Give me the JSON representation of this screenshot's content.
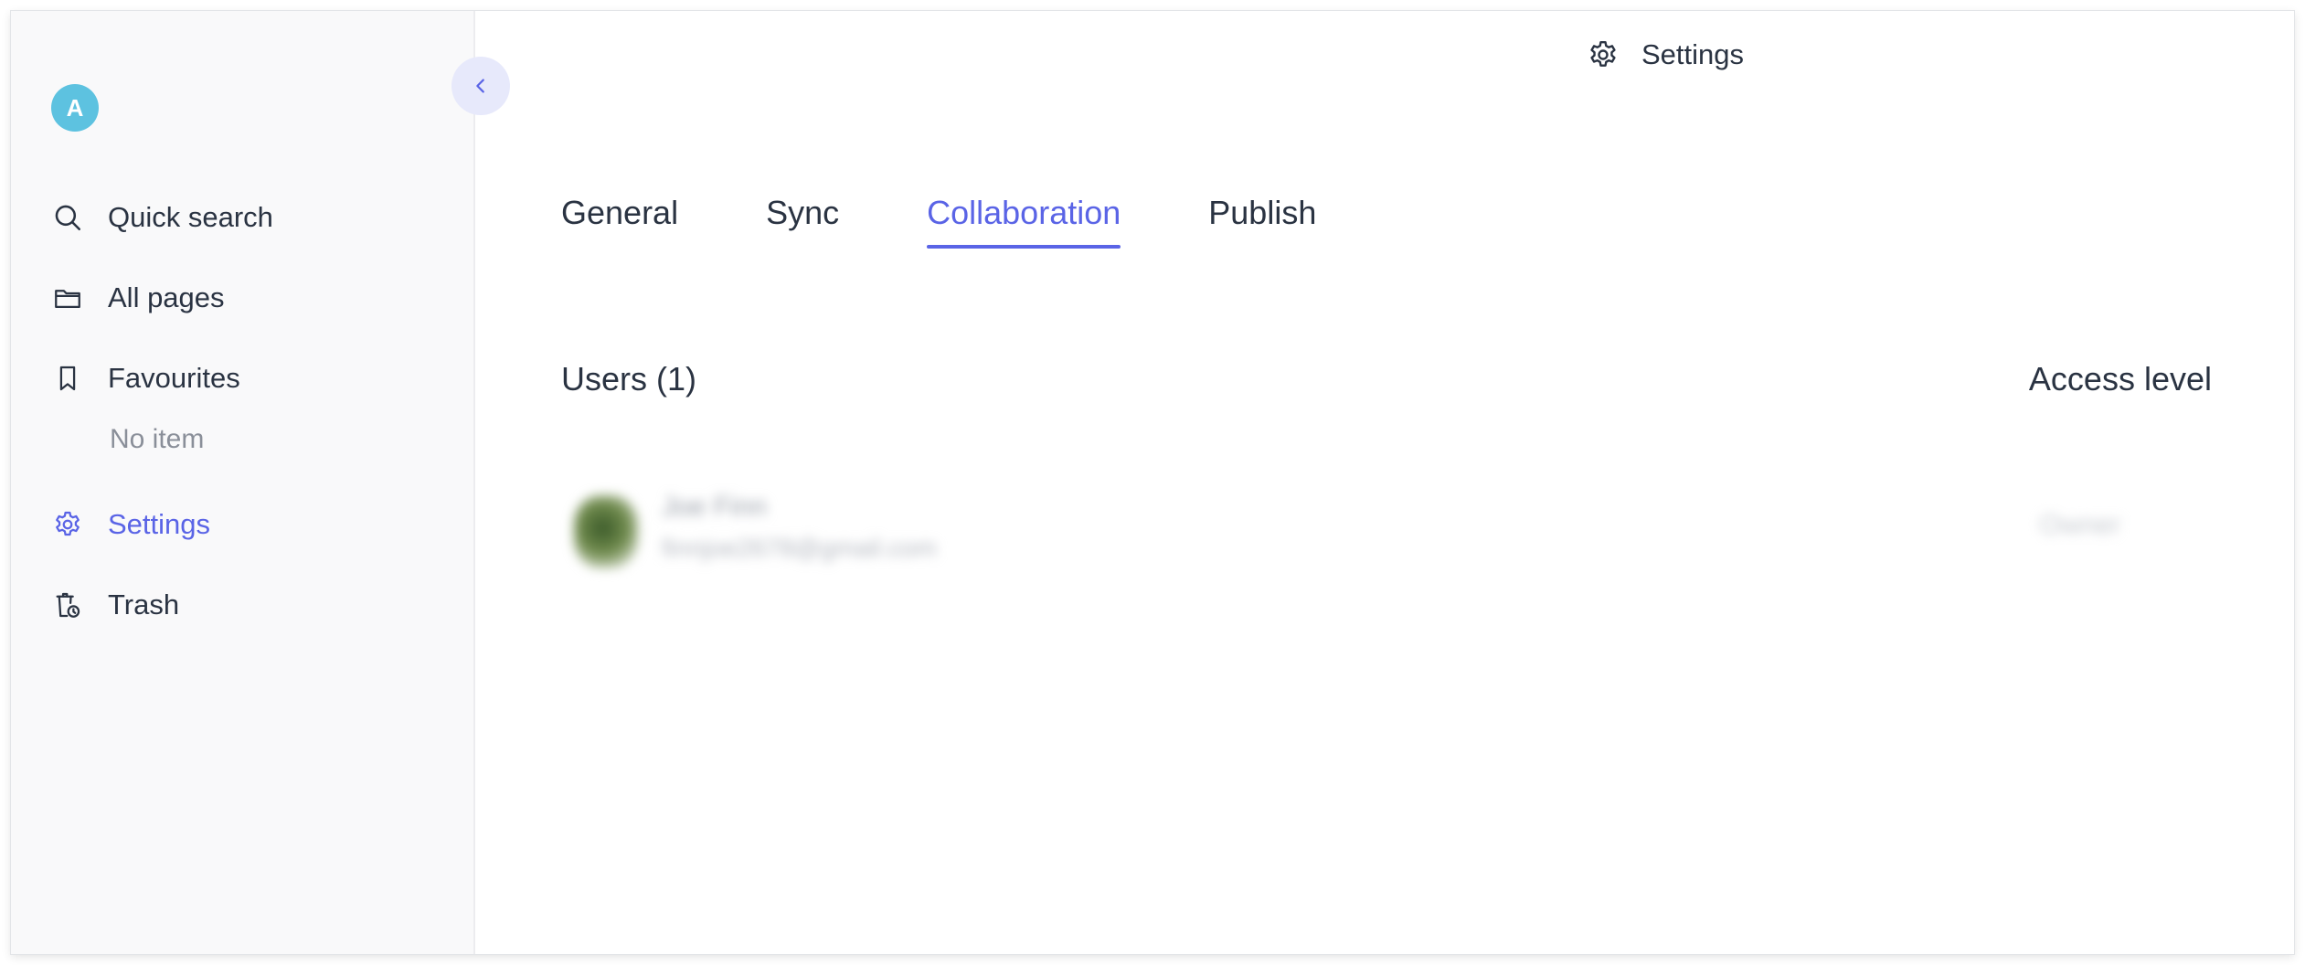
{
  "user": {
    "avatar_letter": "A"
  },
  "sidebar": {
    "items": [
      {
        "label": "Quick search",
        "icon": "search-icon"
      },
      {
        "label": "All pages",
        "icon": "folder-icon"
      },
      {
        "label": "Favourites",
        "icon": "bookmark-icon"
      },
      {
        "label": "Settings",
        "icon": "gear-icon",
        "active": true
      },
      {
        "label": "Trash",
        "icon": "trash-icon"
      }
    ],
    "favourites_empty": "No item"
  },
  "header": {
    "title": "Settings",
    "icon": "gear-icon"
  },
  "tabs": [
    {
      "label": "General"
    },
    {
      "label": "Sync"
    },
    {
      "label": "Collaboration",
      "active": true
    },
    {
      "label": "Publish"
    }
  ],
  "collaboration": {
    "users_title": "Users (1)",
    "access_title": "Access level",
    "users": [
      {
        "name": "Joe Finn",
        "email": "finnjoe2678@gmail.com",
        "role": "Owner"
      }
    ]
  },
  "colors": {
    "accent": "#5a64e6",
    "avatar": "#5dc2e0",
    "sidebar_bg": "#f9f9fa"
  }
}
